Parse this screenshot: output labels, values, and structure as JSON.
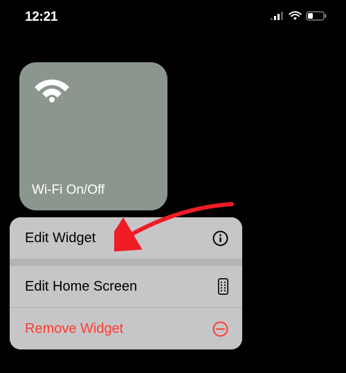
{
  "status_bar": {
    "time": "12:21"
  },
  "widget": {
    "title": "Wi-Fi On/Off"
  },
  "menu": {
    "edit_widget": "Edit Widget",
    "edit_home_screen": "Edit Home Screen",
    "remove_widget": "Remove Widget"
  },
  "colors": {
    "widget_bg": "#8b968e",
    "menu_bg": "#c6c6c8",
    "destructive": "#ff3b30"
  }
}
